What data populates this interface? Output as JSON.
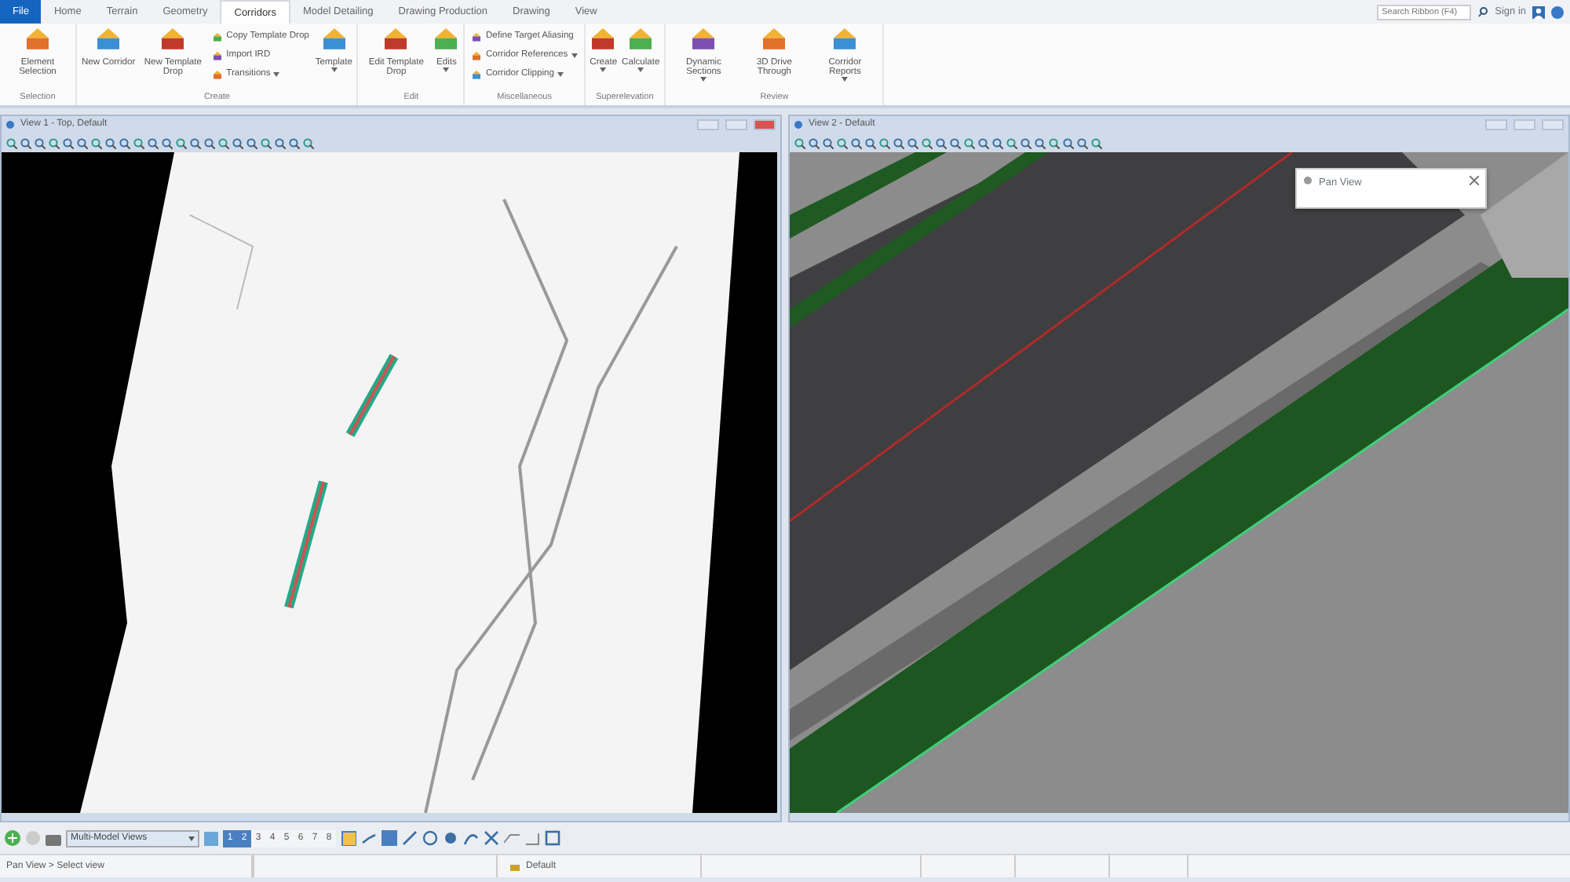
{
  "ribbon_tabs": [
    {
      "label": "File",
      "kind": "file",
      "selected": false
    },
    {
      "label": "Home",
      "kind": "tab",
      "selected": false
    },
    {
      "label": "Terrain",
      "kind": "tab",
      "selected": false
    },
    {
      "label": "Geometry",
      "kind": "tab",
      "selected": false
    },
    {
      "label": "Corridors",
      "kind": "tab",
      "selected": true
    },
    {
      "label": "Model Detailing",
      "kind": "tab",
      "selected": false
    },
    {
      "label": "Drawing Production",
      "kind": "tab",
      "selected": false
    },
    {
      "label": "Drawing",
      "kind": "tab",
      "selected": false
    },
    {
      "label": "View",
      "kind": "tab",
      "selected": false
    }
  ],
  "search": {
    "placeholder": "Search Ribbon (F4)"
  },
  "sign_in": "Sign in",
  "ribbon_groups": [
    {
      "label": "Selection",
      "tools": [
        {
          "label": "Element Selection",
          "kind": "large",
          "dropdown": false
        }
      ]
    },
    {
      "label": "Create",
      "tools": [
        {
          "label": "New Corridor",
          "kind": "large",
          "dropdown": false
        },
        {
          "label": "New Template Drop",
          "kind": "large",
          "dropdown": false
        },
        {
          "label": "Copy Template Drop",
          "kind": "small",
          "dropdown": false
        },
        {
          "label": "Import IRD",
          "kind": "small",
          "dropdown": false
        },
        {
          "label": "Transitions",
          "kind": "small",
          "dropdown": true
        },
        {
          "label": "Template",
          "kind": "large",
          "dropdown": true
        }
      ]
    },
    {
      "label": "Edit",
      "tools": [
        {
          "label": "Edit Template Drop",
          "kind": "large",
          "dropdown": false
        },
        {
          "label": "Edits",
          "kind": "large",
          "dropdown": true
        }
      ]
    },
    {
      "label": "Miscellaneous",
      "tools": [
        {
          "label": "Define Target Aliasing",
          "kind": "small",
          "dropdown": false
        },
        {
          "label": "Corridor References",
          "kind": "small",
          "dropdown": true
        },
        {
          "label": "Corridor Clipping",
          "kind": "small",
          "dropdown": true
        }
      ]
    },
    {
      "label": "Superelevation",
      "tools": [
        {
          "label": "Create",
          "kind": "large",
          "dropdown": true
        },
        {
          "label": "Calculate",
          "kind": "large",
          "dropdown": true
        }
      ]
    },
    {
      "label": "Review",
      "tools": [
        {
          "label": "Dynamic Sections",
          "kind": "large",
          "dropdown": true
        },
        {
          "label": "3D Drive Through",
          "kind": "large",
          "dropdown": false
        },
        {
          "label": "Corridor Reports",
          "kind": "large",
          "dropdown": true
        }
      ]
    }
  ],
  "views": [
    {
      "title": "View 1 - Top, Default",
      "kind": "top"
    },
    {
      "title": "View 2 - Default",
      "kind": "perspective"
    }
  ],
  "pan_view_dialog": {
    "title": "Pan View"
  },
  "bottom_toolbar": {
    "view_group": "Multi-Model Views",
    "view_buttons": [
      {
        "label": "1",
        "selected": true
      },
      {
        "label": "2",
        "selected": true
      },
      {
        "label": "3",
        "selected": false
      },
      {
        "label": "4",
        "selected": false
      },
      {
        "label": "5",
        "selected": false
      },
      {
        "label": "6",
        "selected": false
      },
      {
        "label": "7",
        "selected": false
      },
      {
        "label": "8",
        "selected": false
      }
    ]
  },
  "status_bar": {
    "prompt": "Pan View > Select view",
    "level": "Default"
  }
}
